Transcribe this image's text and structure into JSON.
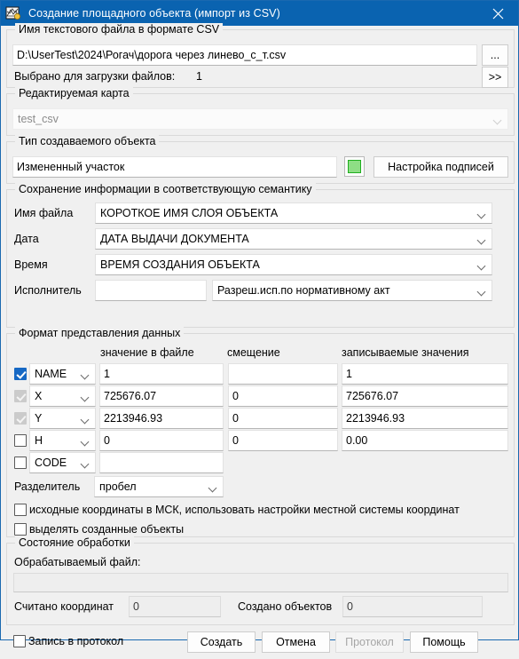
{
  "window": {
    "title": "Создание площадного объекта (импорт из CSV)",
    "app_icon": "map-document-icon",
    "close_icon": "close-icon",
    "titlebar_color": "#0a63b0"
  },
  "file_group": {
    "legend": "Имя текстового файла в формате CSV",
    "path_value": "D:\\UserTest\\2024\\Рогач\\дорога через линево_с_т.csv",
    "browse_label": "...",
    "selected_label": "Выбрано для загрузки файлов:",
    "selected_count": "1",
    "expand_label": ">>"
  },
  "map_group": {
    "legend": "Редактируемая карта",
    "map_value": "test_csv"
  },
  "object_group": {
    "legend": "Тип создаваемого объекта",
    "object_value": "Измененный участок",
    "swatch_color": "#8ede85",
    "swatch_border": "#1fae1f",
    "labels_button": "Настройка подписей"
  },
  "semantics_group": {
    "legend": "Сохранение информации в соответствующую семантику",
    "rows": [
      {
        "label": "Имя файла",
        "value": "КОРОТКОЕ ИМЯ СЛОЯ ОБЪЕКТА"
      },
      {
        "label": "Дата",
        "value": "ДАТА ВЫДАЧИ ДОКУМЕНТА"
      },
      {
        "label": "Время",
        "value": "ВРЕМЯ СОЗДАНИЯ ОБЪЕКТА"
      }
    ],
    "executor_label": "Исполнитель",
    "executor_value": "",
    "executor_combo": "Разреш.исп.по нормативному акт"
  },
  "format_group": {
    "legend": "Формат представления данных",
    "col_headers": {
      "file_value": "значение в файле",
      "offset": "смещение",
      "written": "записываемые значения"
    },
    "rows": [
      {
        "field": "NAME",
        "checked": true,
        "disabled": false,
        "file_value": "1",
        "offset": "",
        "written": "1"
      },
      {
        "field": "X",
        "checked": true,
        "disabled": true,
        "file_value": "725676.07",
        "offset": "0",
        "written": "725676.07"
      },
      {
        "field": "Y",
        "checked": true,
        "disabled": true,
        "file_value": "2213946.93",
        "offset": "0",
        "written": "2213946.93"
      },
      {
        "field": "H",
        "checked": false,
        "disabled": false,
        "file_value": "0",
        "offset": "0",
        "written": "0.00"
      },
      {
        "field": "CODE",
        "checked": false,
        "disabled": false,
        "file_value": "",
        "offset": null,
        "written": null
      }
    ],
    "separator_label": "Разделитель",
    "separator_value": "пробел",
    "msk_option": "исходные координаты в МСК, использовать настройки местной системы координат",
    "msk_checked": false,
    "select_option": "выделять созданные объекты",
    "select_checked": false
  },
  "status_group": {
    "legend": "Состояние обработки",
    "file_label": "Обрабатываемый файл:",
    "file_value": "",
    "read_label": "Считано координат",
    "read_value": "0",
    "created_label": "Создано объектов",
    "created_value": "0"
  },
  "footer": {
    "log_checkbox": "Запись в протокол",
    "log_checked": false,
    "create_button": "Создать",
    "cancel_button": "Отмена",
    "protocol_button": "Протокол",
    "protocol_disabled": true,
    "help_button": "Помощь"
  }
}
